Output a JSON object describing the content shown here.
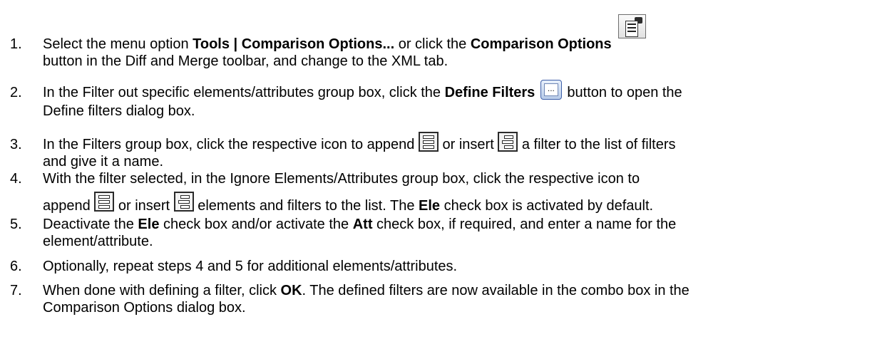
{
  "steps": [
    {
      "num": "1.",
      "p1": "Select the menu option ",
      "b1": "Tools | Comparison Options...",
      "p2": " or click the ",
      "b2": "Comparison Options",
      "cont": " button in the Diff and Merge toolbar, and change to the XML tab."
    },
    {
      "num": "2.",
      "p1": "In the Filter out specific elements/attributes group box, click the ",
      "b1": "Define Filters",
      "p2": " button to open the",
      "cont": "Define filters dialog box."
    },
    {
      "num": "3.",
      "p1": "In the Filters group box, click the respective icon to append ",
      "p2": " or insert ",
      "p3": " a filter to the list of filters",
      "cont": "and give it a name."
    },
    {
      "num": "4.",
      "p1": "With the filter selected, in the Ignore Elements/Attributes group box, click the respective icon to",
      "c1": "append ",
      "c2": " or insert ",
      "c3": " elements and filters to the list. The ",
      "cb": "Ele",
      "c4": " check box is activated by default."
    },
    {
      "num": "5.",
      "p1": "Deactivate the ",
      "b1": "Ele",
      "p2": " check box and/or activate the ",
      "b2": "Att",
      "p3": " check box, if required, and enter a name for the",
      "cont": "element/attribute."
    },
    {
      "num": "6.",
      "p1": "Optionally, repeat steps 4 and 5 for additional elements/attributes."
    },
    {
      "num": "7.",
      "p1": "When done with defining a filter, click ",
      "b1": "OK",
      "p2": ". The defined filters are now available in the combo box in the",
      "cont": "Comparison Options dialog box."
    }
  ],
  "icons": {
    "comparison_options": "comparison-options-icon",
    "define_filters": "define-filters-icon",
    "append": "append-icon",
    "insert": "insert-icon"
  }
}
